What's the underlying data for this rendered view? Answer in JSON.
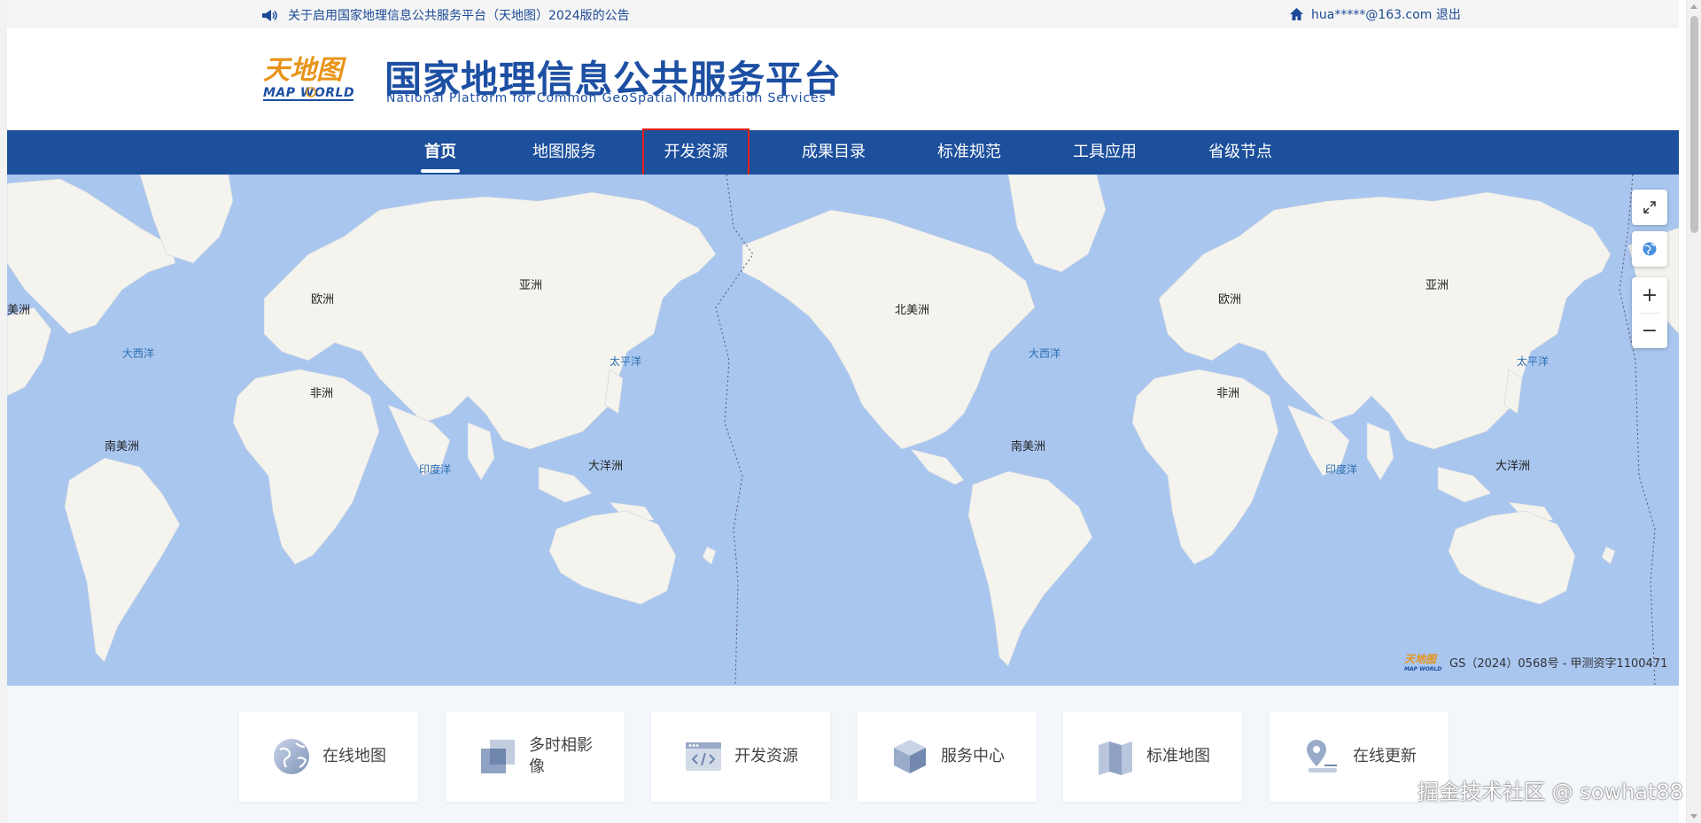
{
  "topbar": {
    "notice": "关于启用国家地理信息公共服务平台（天地图）2024版的公告",
    "user": "hua*****@163.com 退出"
  },
  "header": {
    "logo_top": "天地图",
    "logo_bottom": "MAP WORLD",
    "title_cn": "国家地理信息公共服务平台",
    "title_en": "National Platform for Common GeoSpatial Information Services"
  },
  "nav": {
    "items": [
      {
        "label": "首页"
      },
      {
        "label": "地图服务"
      },
      {
        "label": "开发资源"
      },
      {
        "label": "成果目录"
      },
      {
        "label": "标准规范"
      },
      {
        "label": "工具应用"
      },
      {
        "label": "省级节点"
      }
    ]
  },
  "map": {
    "labels": {
      "americas_partial": "美洲",
      "europe_1": "欧洲",
      "asia_1": "亚洲",
      "north_america": "北美洲",
      "europe_2": "欧洲",
      "asia_2": "亚洲",
      "africa_1": "非洲",
      "africa_2": "非洲",
      "south_america_1": "南美洲",
      "south_america_2": "南美洲",
      "oceania_1": "大洋洲",
      "oceania_2": "大洋洲"
    },
    "oceans": {
      "atlantic_1": "大西洋",
      "pacific_1": "太平洋",
      "atlantic_2": "大西洋",
      "pacific_2": "太平洋",
      "indian_1": "印度洋",
      "indian_2": "印度洋"
    },
    "copyright": "GS（2024）0568号 - 甲测资字1100471",
    "controls": {
      "zoom_in": "+",
      "zoom_out": "−"
    }
  },
  "cards": [
    {
      "label": "在线地图",
      "icon": "globe-icon"
    },
    {
      "label": "多时相影像",
      "icon": "layers-icon"
    },
    {
      "label": "开发资源",
      "icon": "code-window-icon"
    },
    {
      "label": "服务中心",
      "icon": "cube-icon"
    },
    {
      "label": "标准地图",
      "icon": "folded-map-icon"
    },
    {
      "label": "在线更新",
      "icon": "location-pin-icon"
    }
  ],
  "watermark": "掘金技术社区 @ sowhat88",
  "colors": {
    "nav_bg": "#1c4f9c",
    "brand_blue": "#1d4fa3",
    "ocean": "#a9c6ef",
    "land": "#f4f3ee",
    "highlight": "#e62117",
    "logo_orange": "#e8941a"
  }
}
